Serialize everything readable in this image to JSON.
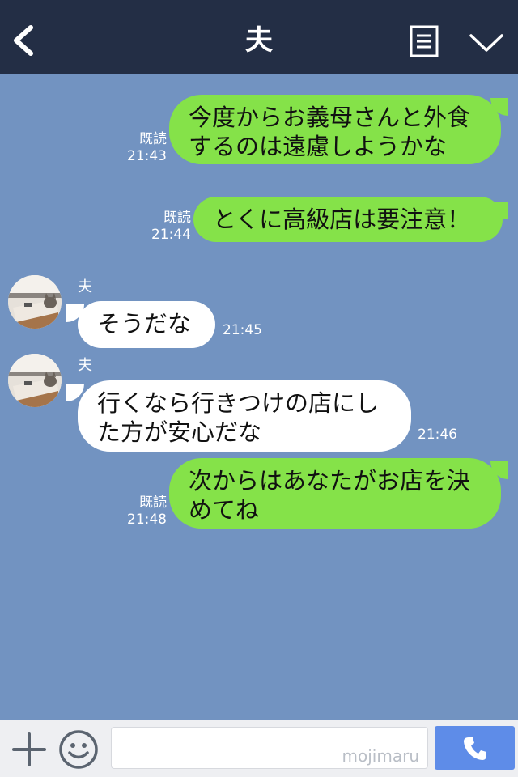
{
  "header": {
    "title": "夫",
    "back_icon": "chevron-left-icon",
    "notes_icon": "notes-icon",
    "menu_icon": "chevron-down-icon"
  },
  "messages": [
    {
      "direction": "outgoing",
      "lines": [
        "今度からお義母さんと外食",
        "するのは遠慮しようかな"
      ],
      "read": "既読",
      "time": "21:43"
    },
    {
      "direction": "outgoing",
      "lines": [
        "とくに高級店は要注意！"
      ],
      "read": "既読",
      "time": "21:44"
    },
    {
      "direction": "incoming",
      "sender": "夫",
      "lines": [
        "そうだな"
      ],
      "time": "21:45"
    },
    {
      "direction": "incoming",
      "sender": "夫",
      "lines": [
        "行くなら行きつけの店にし",
        "た方が安心だな"
      ],
      "time": "21:46"
    },
    {
      "direction": "outgoing",
      "lines": [
        "次からはあなたがお店を決",
        "めてね"
      ],
      "read": "既読",
      "time": "21:48"
    }
  ],
  "input_bar": {
    "plus_icon": "plus-icon",
    "emoji_icon": "smiley-icon",
    "input_value": "",
    "watermark": "mojimaru",
    "call_icon": "phone-icon"
  },
  "colors": {
    "header_bg": "#232e45",
    "chat_bg": "#7293c1",
    "outgoing_bubble": "#85e249",
    "incoming_bubble": "#ffffff",
    "call_button": "#5e8ce8"
  }
}
